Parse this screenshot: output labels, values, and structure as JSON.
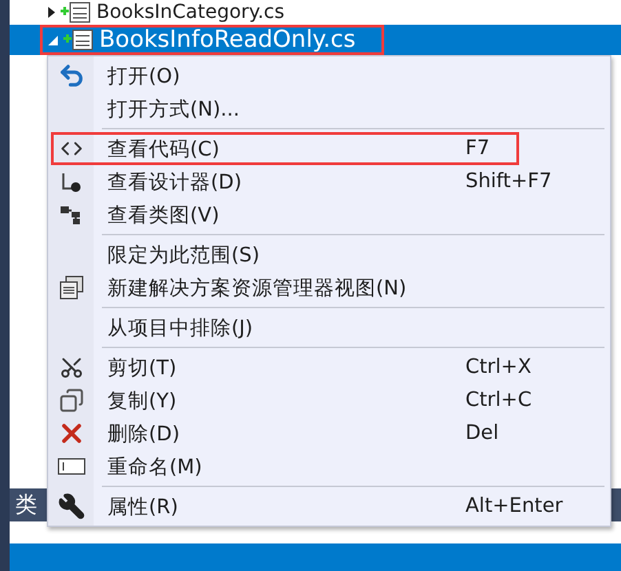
{
  "tree": {
    "rows": [
      {
        "label": "BooksInCategory.cs",
        "expanded": false,
        "selected": false,
        "annotated": false
      },
      {
        "label": "BooksInfoReadOnly.cs",
        "expanded": true,
        "selected": true,
        "annotated": true
      }
    ]
  },
  "bottom_tab": {
    "label": "类"
  },
  "context_menu": {
    "items": [
      {
        "kind": "item",
        "label": "打开(O)",
        "annotated": false
      },
      {
        "kind": "item",
        "label": "打开方式(N)...",
        "annotated": false
      },
      {
        "kind": "separator"
      },
      {
        "kind": "item",
        "label": "查看代码(C)",
        "shortcut": "F7",
        "annotated": true
      },
      {
        "kind": "item",
        "label": "查看设计器(D)",
        "shortcut": "Shift+F7",
        "annotated": false
      },
      {
        "kind": "item",
        "label": "查看类图(V)",
        "annotated": false
      },
      {
        "kind": "separator"
      },
      {
        "kind": "item",
        "label": "限定为此范围(S)",
        "annotated": false
      },
      {
        "kind": "item",
        "label": "新建解决方案资源管理器视图(N)",
        "annotated": false
      },
      {
        "kind": "separator"
      },
      {
        "kind": "item",
        "label": "从项目中排除(J)",
        "annotated": false
      },
      {
        "kind": "separator"
      },
      {
        "kind": "item",
        "label": "剪切(T)",
        "shortcut": "Ctrl+X",
        "annotated": false
      },
      {
        "kind": "item",
        "label": "复制(Y)",
        "shortcut": "Ctrl+C",
        "annotated": false
      },
      {
        "kind": "item",
        "label": "删除(D)",
        "shortcut": "Del",
        "annotated": false
      },
      {
        "kind": "item",
        "label": "重命名(M)",
        "annotated": false
      },
      {
        "kind": "separator"
      },
      {
        "kind": "item",
        "label": "属性(R)",
        "shortcut": "Alt+Enter",
        "annotated": false
      }
    ]
  }
}
